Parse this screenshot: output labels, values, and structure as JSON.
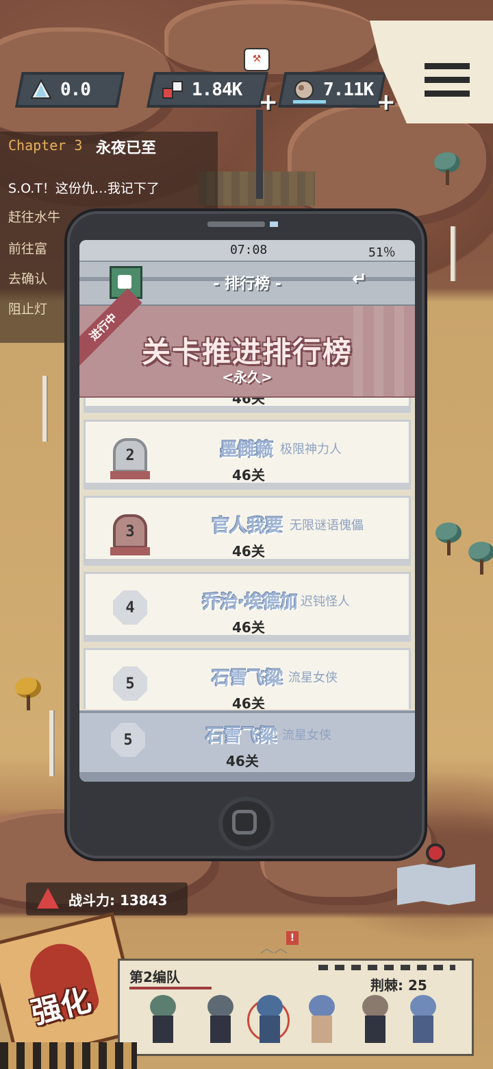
{
  "hud": {
    "resources": [
      {
        "id": "crystal",
        "value": "0.0",
        "icon": "crystal-icon"
      },
      {
        "id": "parts",
        "value": "1.84K",
        "icon": "parts-icon",
        "plus": "+"
      },
      {
        "id": "ore",
        "value": "7.11K",
        "icon": "ore-icon",
        "plus": "+"
      }
    ],
    "menu_icon": "hamburger-menu-icon",
    "pin_icon": "hammer-upgrade-icon"
  },
  "quest": {
    "chapter": "Chapter 3",
    "chapter_name": "永夜已至",
    "items": [
      "S.O.T！这份仇…我记下了",
      "赶往水牛",
      "前往富",
      "去确认",
      "阻止灯"
    ]
  },
  "phone": {
    "time": "07:08",
    "battery": "51％",
    "title": "- 排行榜 -",
    "back_icon": "back-arrow-icon",
    "app_icon": "cup-icon",
    "banner": {
      "tag": "进行中",
      "title": "关卡推进排行榜",
      "subtitle": "<永久>"
    },
    "rows": [
      {
        "rank": "2",
        "name": "墨雠籁",
        "title": "极限神力人",
        "level": "46关"
      },
      {
        "rank": "3",
        "name": "官人我要",
        "title": "无限谜语傀儡",
        "level": "46关"
      },
      {
        "rank": "4",
        "name": "乔治·埃德加",
        "title": "迟钝怪人",
        "level": "46关"
      },
      {
        "rank": "5",
        "name": "石雪飞粱",
        "title": "流星女侠",
        "level": "46关"
      }
    ],
    "partial_row_level": "46关",
    "self_row": {
      "rank": "5",
      "name": "石雪飞粱",
      "title": "流星女侠",
      "level": "46关"
    }
  },
  "bottom": {
    "power_label": "战斗力: 13843",
    "strengthen_label": "强化",
    "team_name": "第2编队",
    "cost_label": "荆棘: 25",
    "alert": "!",
    "map_icon": "map-icon"
  },
  "colors": {
    "banner": "#b89294",
    "rank_name": "#9fb4d4",
    "phone_body": "#35373c",
    "accent_red": "#c6343a"
  }
}
